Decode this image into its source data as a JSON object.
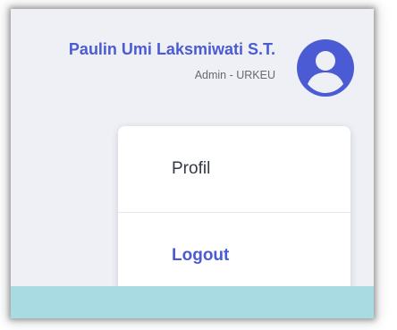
{
  "user": {
    "name": "Paulin Umi Laksmiwati S.T.",
    "role": "Admin - URKEU"
  },
  "avatar": {
    "icon": "user-circle-icon",
    "color": "#4a5bd4"
  },
  "menu": {
    "items": [
      {
        "label": "Profil"
      },
      {
        "label": "Logout"
      }
    ]
  },
  "colors": {
    "accent": "#4a5bd4",
    "background": "#eef0f5",
    "strip": "#a9dbe3"
  }
}
